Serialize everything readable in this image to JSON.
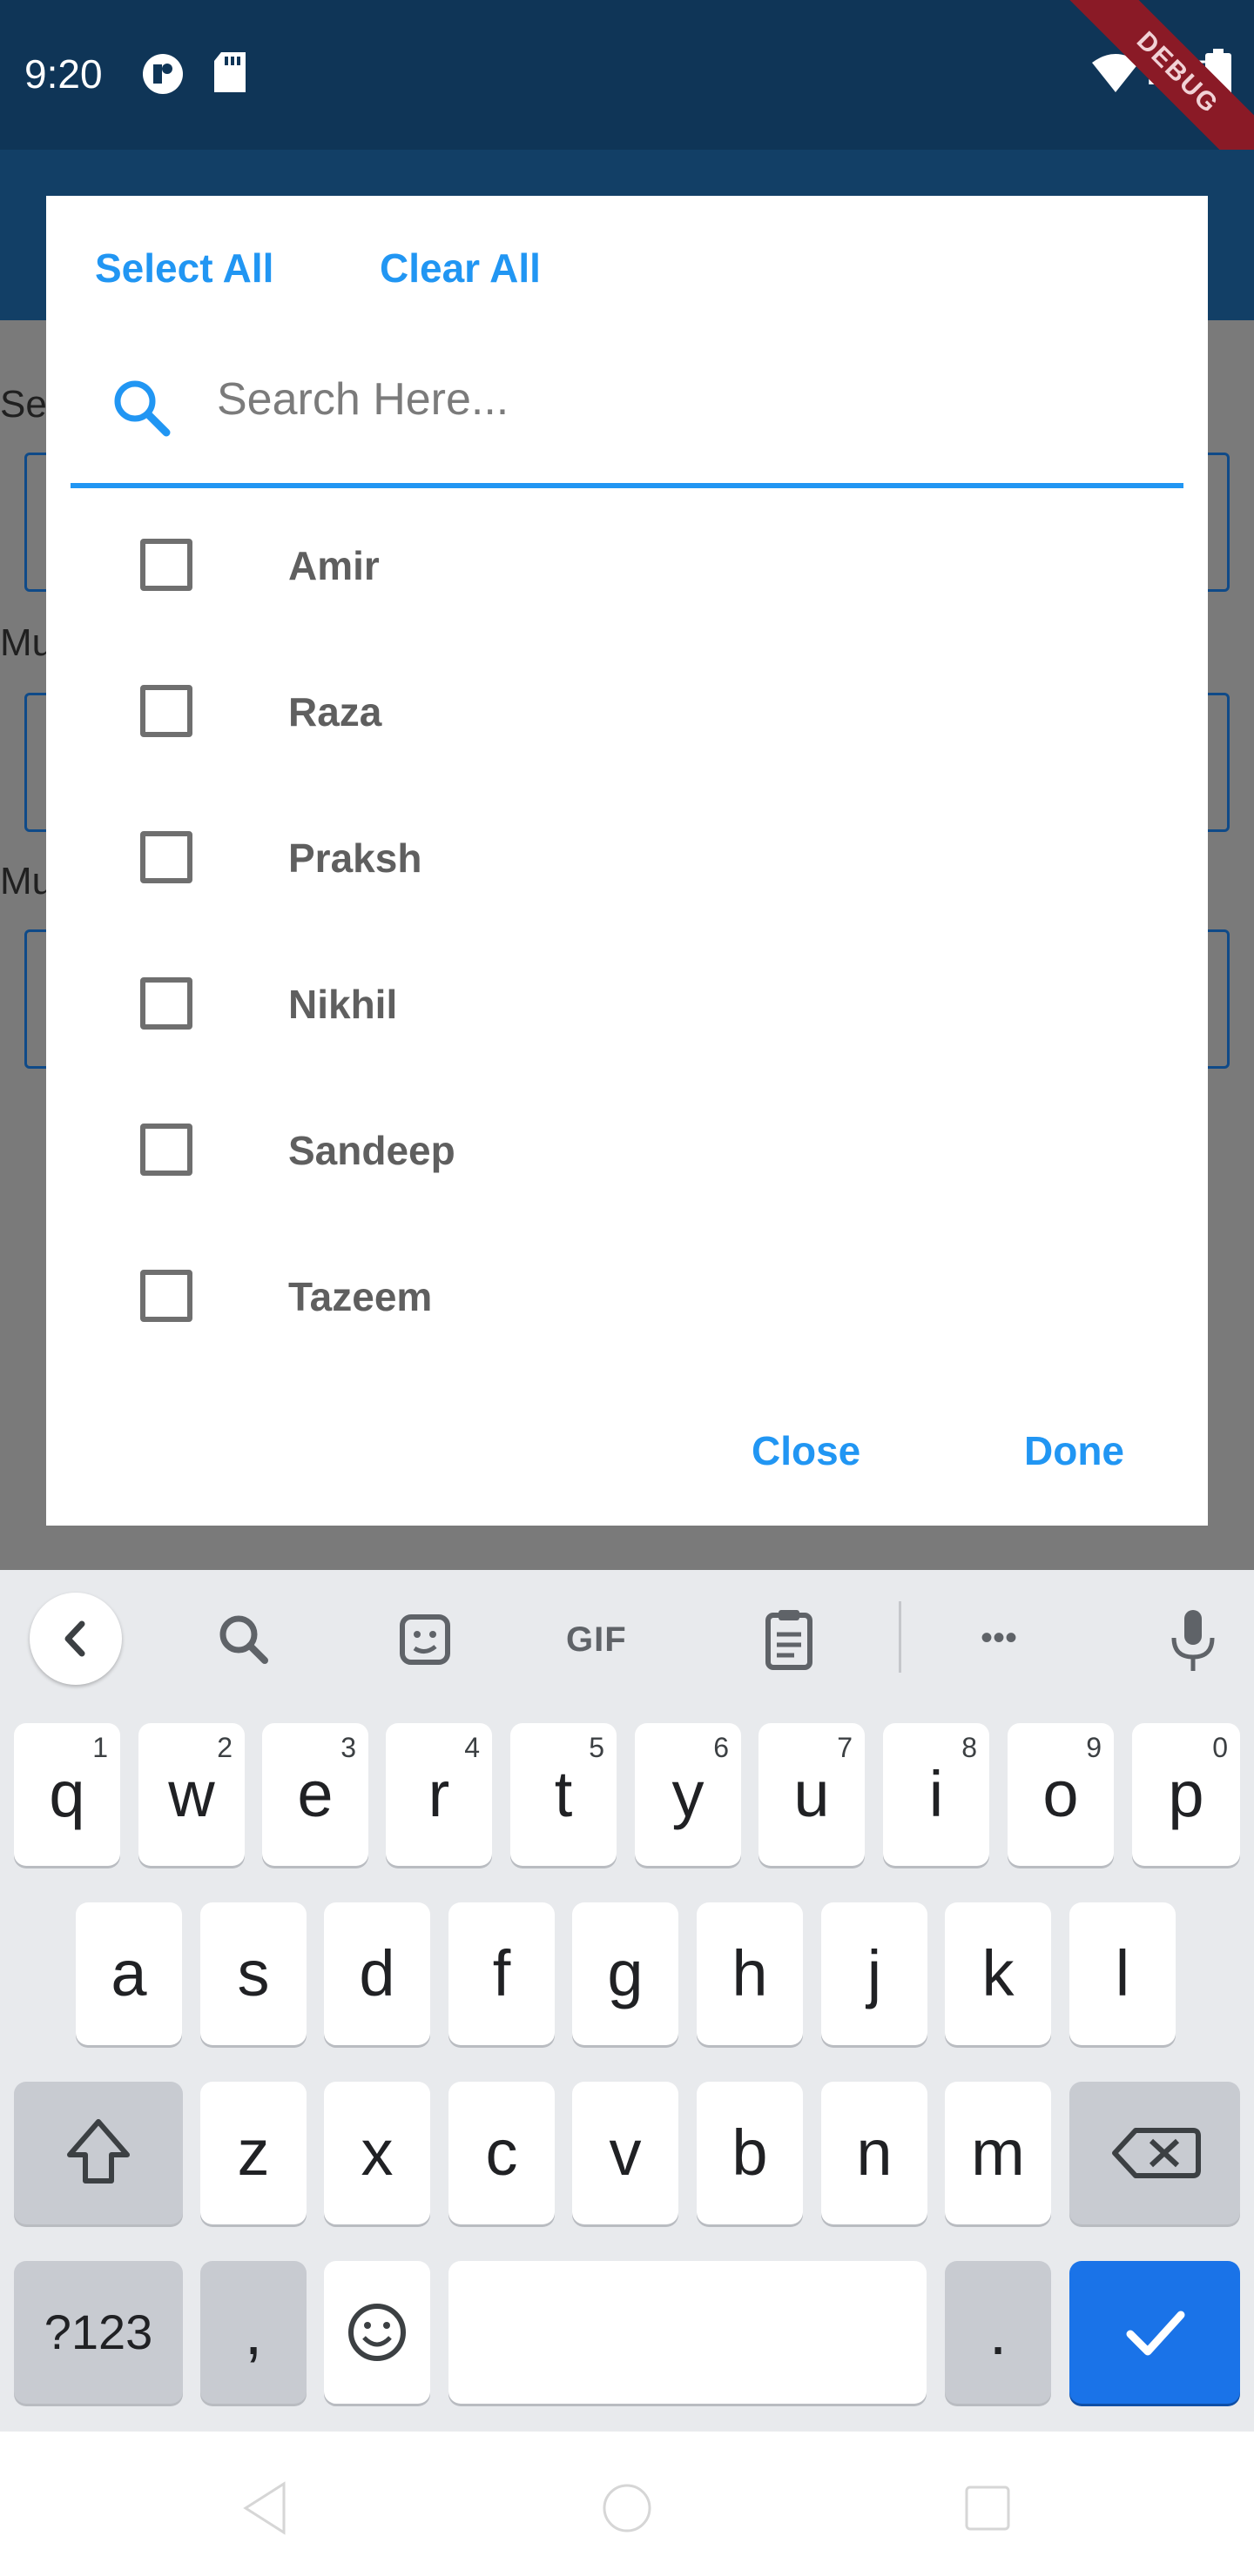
{
  "status_bar": {
    "time": "9:20",
    "network": "LTE",
    "debug_banner": "DEBUG",
    "icons": [
      "app-notification-icon",
      "sd-card-icon",
      "wifi-icon",
      "battery-icon"
    ]
  },
  "background_page": {
    "labels": [
      "Se",
      "Mu",
      "Mu"
    ]
  },
  "dialog": {
    "select_all_label": "Select All",
    "clear_all_label": "Clear All",
    "search_placeholder": "Search Here...",
    "options": [
      {
        "label": "Amir",
        "checked": false
      },
      {
        "label": "Raza",
        "checked": false
      },
      {
        "label": "Praksh",
        "checked": false
      },
      {
        "label": "Nikhil",
        "checked": false
      },
      {
        "label": "Sandeep",
        "checked": false
      },
      {
        "label": "Tazeem",
        "checked": false
      }
    ],
    "close_label": "Close",
    "done_label": "Done",
    "accent_color": "#2196f3"
  },
  "keyboard": {
    "toolbar": [
      "back-icon",
      "search-icon",
      "sticker-icon",
      "gif-icon",
      "clipboard-icon",
      "more-icon",
      "microphone-icon"
    ],
    "gif_label": "GIF",
    "more_label": "•••",
    "row1": [
      {
        "key": "q",
        "hint": "1"
      },
      {
        "key": "w",
        "hint": "2"
      },
      {
        "key": "e",
        "hint": "3"
      },
      {
        "key": "r",
        "hint": "4"
      },
      {
        "key": "t",
        "hint": "5"
      },
      {
        "key": "y",
        "hint": "6"
      },
      {
        "key": "u",
        "hint": "7"
      },
      {
        "key": "i",
        "hint": "8"
      },
      {
        "key": "o",
        "hint": "9"
      },
      {
        "key": "p",
        "hint": "0"
      }
    ],
    "row2": [
      "a",
      "s",
      "d",
      "f",
      "g",
      "h",
      "j",
      "k",
      "l"
    ],
    "row3": [
      "z",
      "x",
      "c",
      "v",
      "b",
      "n",
      "m"
    ],
    "symbols_label": "?123",
    "comma_label": ",",
    "period_label": ".",
    "action_color": "#1a73e8"
  },
  "nav_bar": {
    "icons": [
      "back-triangle-icon",
      "home-circle-icon",
      "recents-square-icon"
    ]
  }
}
